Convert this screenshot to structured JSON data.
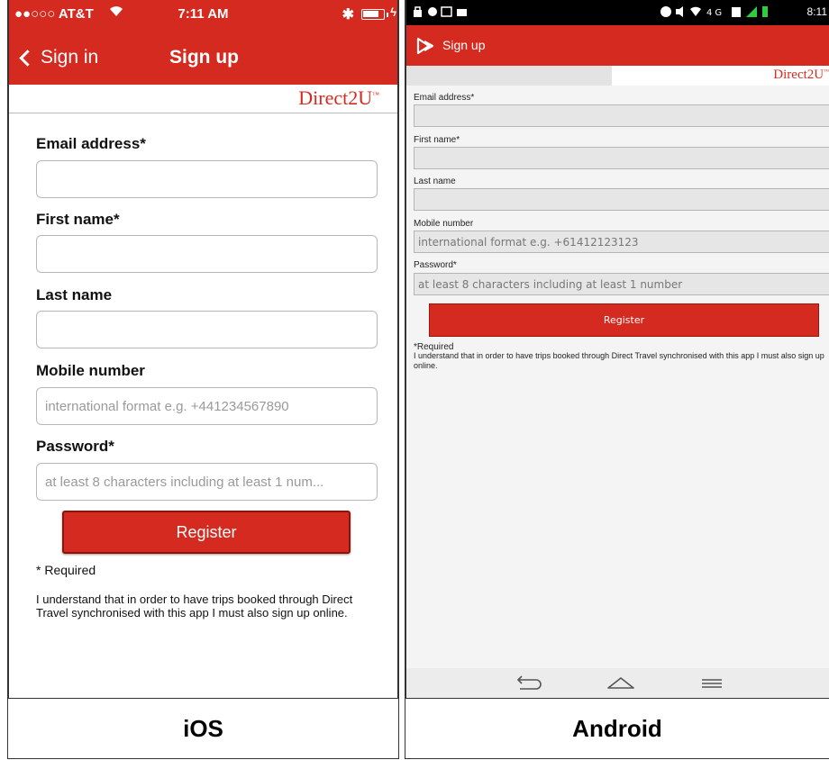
{
  "ios": {
    "status": {
      "carrier": "●●○○○ AT&T",
      "time": "7:11 AM"
    },
    "nav": {
      "back_label": "Sign in",
      "title": "Sign up"
    },
    "brand": {
      "logo_text": "Direct2U",
      "logo_mark": "™"
    },
    "fields": [
      {
        "label": "Email address*",
        "placeholder": "",
        "value": ""
      },
      {
        "label": "First name*",
        "placeholder": "",
        "value": ""
      },
      {
        "label": "Last name",
        "placeholder": "",
        "value": ""
      },
      {
        "label": "Mobile number",
        "placeholder": "international format e.g. +441234567890",
        "value": ""
      },
      {
        "label": "Password*",
        "placeholder": "at least 8 characters including at least 1 num...",
        "value": ""
      }
    ],
    "register_label": "Register",
    "required_note": "* Required",
    "sync_note": "I understand that in order to have trips booked through Direct Travel synchronised with this app I must also sign up online.",
    "caption": "iOS"
  },
  "android": {
    "status": {
      "time": "8:11"
    },
    "actionbar": {
      "title": "Sign up"
    },
    "brand": {
      "logo_text": "Direct2U",
      "logo_mark": "™"
    },
    "fields": [
      {
        "label": "Email address*",
        "placeholder": "",
        "value": ""
      },
      {
        "label": "First name*",
        "placeholder": "",
        "value": ""
      },
      {
        "label": "Last name",
        "placeholder": "",
        "value": ""
      },
      {
        "label": "Mobile number",
        "placeholder": "international format e.g. +61412123123",
        "value": ""
      },
      {
        "label": "Password*",
        "placeholder": "at least 8 characters including at least 1 number",
        "value": ""
      }
    ],
    "register_label": "Register",
    "required_note": "*Required",
    "sync_note": "I understand that in order to have trips booked through Direct Travel synchronised with this app I must also sign up online.",
    "caption": "Android"
  },
  "colors": {
    "brand_red": "#d52a1f",
    "dark_red": "#8e130c"
  },
  "icons": [
    "wifi-icon",
    "bluetooth-icon",
    "battery-icon",
    "back-chevron-icon",
    "app-logo-icon",
    "android-back-icon",
    "android-home-icon",
    "android-menu-icon"
  ]
}
